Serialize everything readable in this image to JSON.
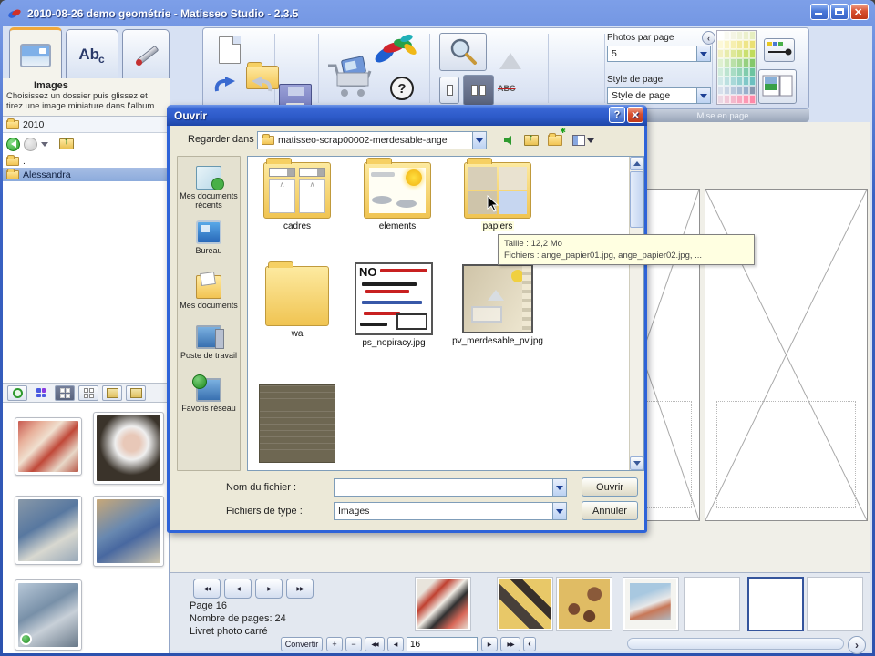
{
  "titlebar": {
    "title": "2010-08-26 demo geométrie - Matisseo Studio - 2.3.5"
  },
  "icons": {
    "text_tab_ab": "Ab",
    "text_tab_c": "c",
    "abc": "ABC",
    "help": "?",
    "first": "◀◀",
    "prev": "◀",
    "next": "▶",
    "last": "▶▶",
    "plus": "+",
    "minus": "−",
    "collapse": "‹",
    "expand": "›",
    "hanger": "∧",
    "no_piracy": "NO"
  },
  "panel": {
    "heading": "Images",
    "description": "Choisissez un dossier puis glissez et tirez une image miniature dans l'album...",
    "folder_value": "2010",
    "tree_dot": ".",
    "tree_selected": "Alessandra"
  },
  "ribbon": {
    "photos_per_page_label": "Photos par page",
    "photos_per_page_value": "5",
    "style_label": "Style de page",
    "style_value": "Style de page",
    "mise_en_page": "Mise en page",
    "palette": [
      "#ffffff",
      "#f9f9f1",
      "#f4f4e4",
      "#eff2d8",
      "#ebf0cc",
      "#e6eec0",
      "#fdf9d8",
      "#faf4c4",
      "#f6efb0",
      "#f2ea9c",
      "#eee588",
      "#eae074",
      "#f2f0c0",
      "#e8ecac",
      "#dee898",
      "#d4e484",
      "#cae070",
      "#c0dc5c",
      "#def0d0",
      "#cce8bc",
      "#bae0a8",
      "#a8d894",
      "#96d080",
      "#84c86c",
      "#d0ecdc",
      "#bce4d0",
      "#a8dcc4",
      "#94d4b8",
      "#80ccac",
      "#6cc4a0",
      "#d0e8e8",
      "#bce0e0",
      "#a8d8d8",
      "#94d0d0",
      "#80c8c8",
      "#6cc0c0",
      "#d8e0ec",
      "#c8d4e4",
      "#b8c8dc",
      "#a8bcd4",
      "#98b0cc",
      "#8898b0",
      "#ecd8e4",
      "#f0c8d8",
      "#f4b8cc",
      "#f8a8c0",
      "#fc98b4",
      "#ff88a8"
    ]
  },
  "dialog": {
    "title": "Ouvrir",
    "look_in_label": "Regarder dans :",
    "look_in_value": "matisseo-scrap00002-merdesable-ange",
    "places": [
      "Mes documents récents",
      "Bureau",
      "Mes documents",
      "Poste de travail",
      "Favoris réseau"
    ],
    "files": [
      "cadres",
      "elements",
      "papiers",
      "wa",
      "ps_nopiracy.jpg",
      "pv_merdesable_pv.jpg"
    ],
    "tooltip_line1": "Taille : 12,2 Mo",
    "tooltip_line2": "Fichiers : ange_papier01.jpg, ange_papier02.jpg, ...",
    "filename_label": "Nom du fichier :",
    "filetype_label": "Fichiers de type :",
    "filetype_value": "Images",
    "open": "Ouvrir",
    "cancel": "Annuler"
  },
  "bottom": {
    "page": "Page 16",
    "count": "Nombre de pages: 24",
    "book": "Livret photo carré",
    "convert": "Convertir",
    "page_value": "16"
  }
}
